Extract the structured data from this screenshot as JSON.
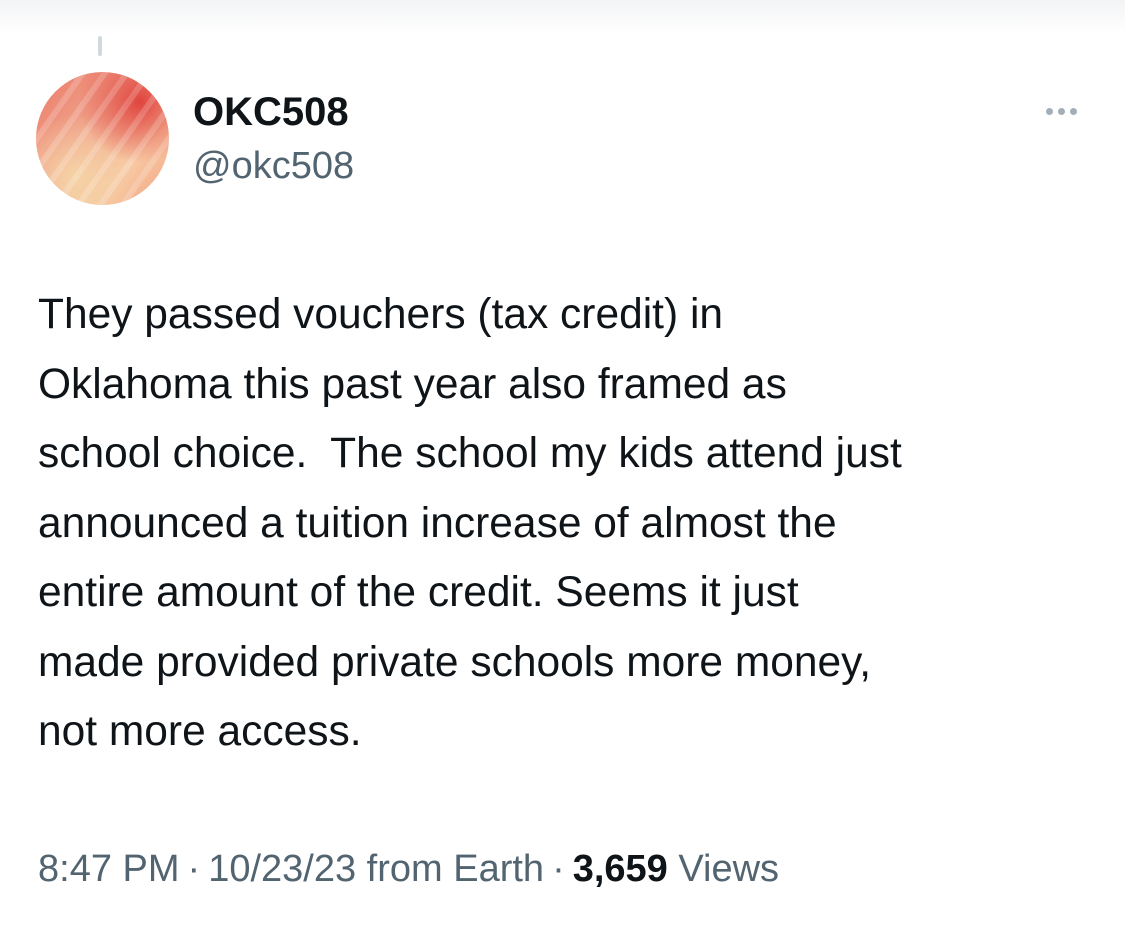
{
  "author": {
    "display_name": "OKC508",
    "handle": "@okc508"
  },
  "tweet": {
    "text": "They passed vouchers (tax credit) in\nOklahoma this past year also framed as\nschool choice.  The school my kids attend just\nannounced a tuition increase of almost the\nentire amount of the credit. Seems it just\nmade provided private schools more money,\nnot more access."
  },
  "meta": {
    "time": "8:47 PM",
    "date": "10/23/23",
    "source": "from Earth",
    "separator": "·",
    "views_count": "3,659",
    "views_label": "Views"
  },
  "icons": {
    "more": "more-horizontal-icon"
  },
  "colors": {
    "primary_text": "#0f1419",
    "secondary_text": "#536471",
    "avatar_accent": "#e0453f"
  }
}
